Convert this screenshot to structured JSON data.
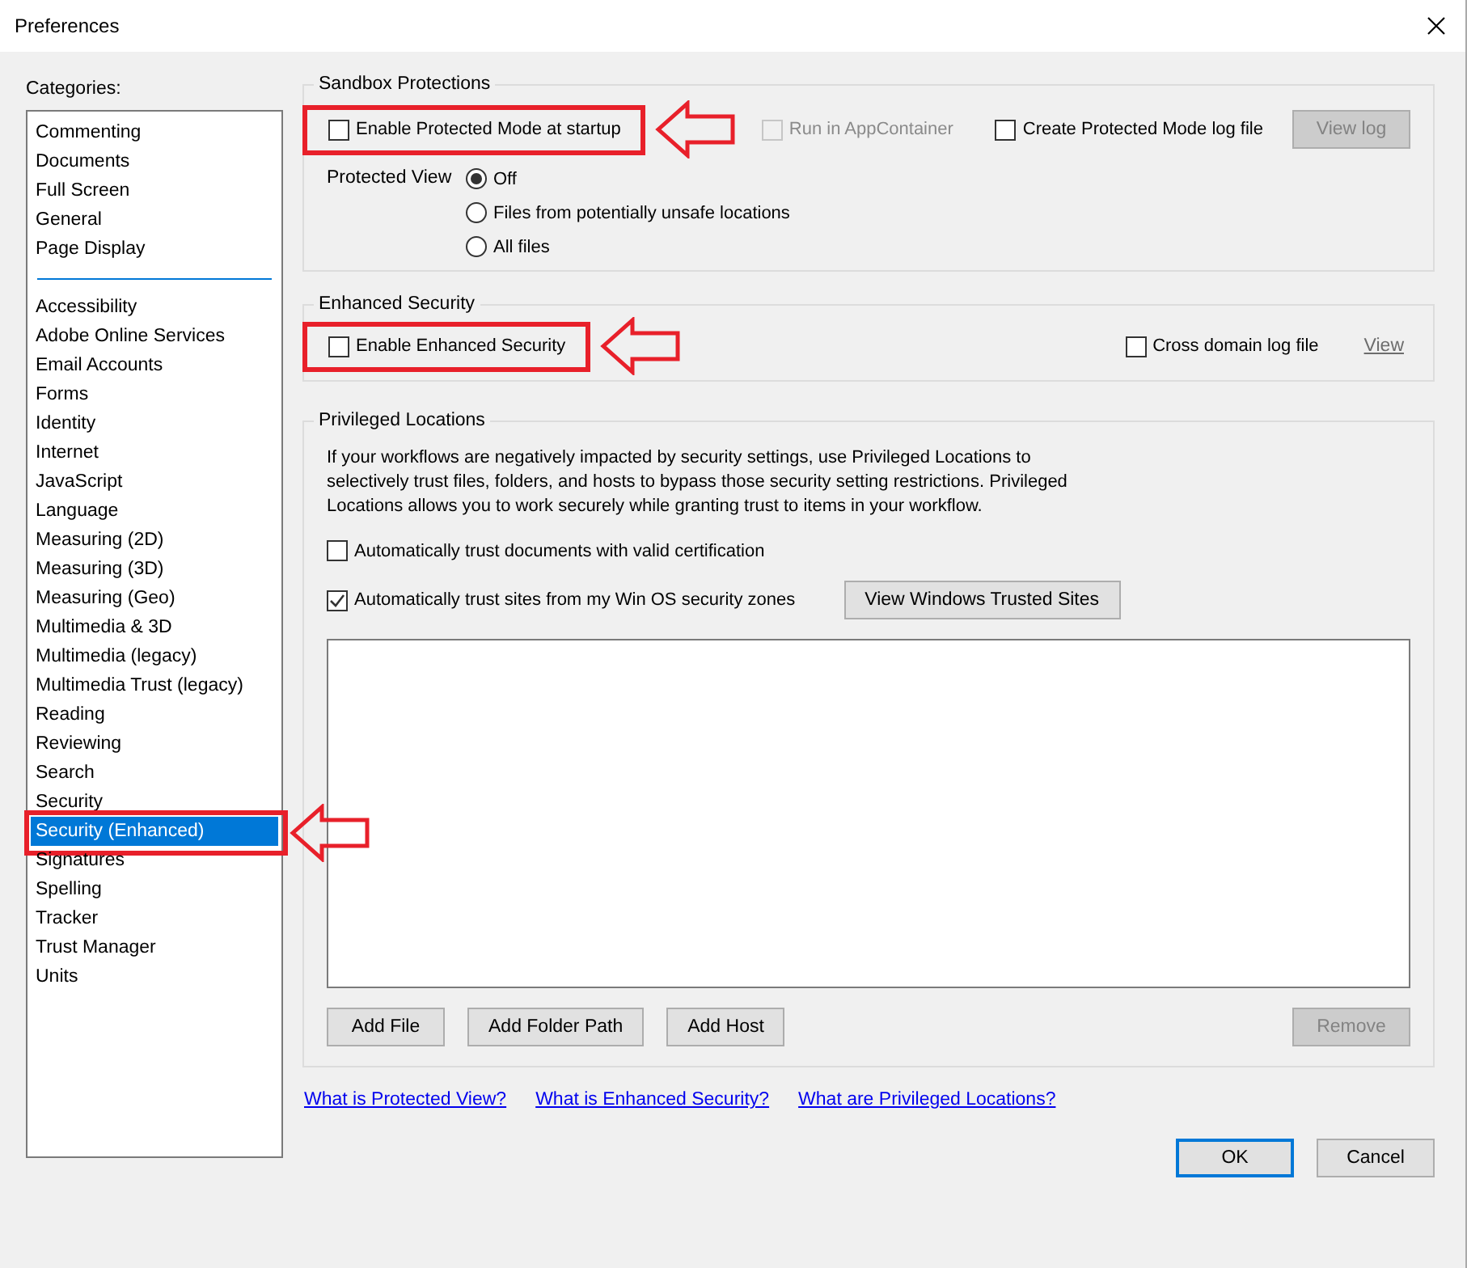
{
  "window": {
    "title": "Preferences"
  },
  "categories_label": "Categories:",
  "categories": [
    {
      "items": [
        {
          "label": "Commenting",
          "selected": false,
          "highlighted": false
        },
        {
          "label": "Documents",
          "selected": false,
          "highlighted": false
        },
        {
          "label": "Full Screen",
          "selected": false,
          "highlighted": false
        },
        {
          "label": "General",
          "selected": false,
          "highlighted": false
        },
        {
          "label": "Page Display",
          "selected": false,
          "highlighted": false
        }
      ]
    },
    {
      "items": [
        {
          "label": "Accessibility",
          "selected": false,
          "highlighted": false
        },
        {
          "label": "Adobe Online Services",
          "selected": false,
          "highlighted": false
        },
        {
          "label": "Email Accounts",
          "selected": false,
          "highlighted": false
        },
        {
          "label": "Forms",
          "selected": false,
          "highlighted": false
        },
        {
          "label": "Identity",
          "selected": false,
          "highlighted": false
        },
        {
          "label": "Internet",
          "selected": false,
          "highlighted": false
        },
        {
          "label": "JavaScript",
          "selected": false,
          "highlighted": false
        },
        {
          "label": "Language",
          "selected": false,
          "highlighted": false
        },
        {
          "label": "Measuring (2D)",
          "selected": false,
          "highlighted": false
        },
        {
          "label": "Measuring (3D)",
          "selected": false,
          "highlighted": false
        },
        {
          "label": "Measuring (Geo)",
          "selected": false,
          "highlighted": false
        },
        {
          "label": "Multimedia & 3D",
          "selected": false,
          "highlighted": false
        },
        {
          "label": "Multimedia (legacy)",
          "selected": false,
          "highlighted": false
        },
        {
          "label": "Multimedia Trust (legacy)",
          "selected": false,
          "highlighted": false
        },
        {
          "label": "Reading",
          "selected": false,
          "highlighted": false
        },
        {
          "label": "Reviewing",
          "selected": false,
          "highlighted": false
        },
        {
          "label": "Search",
          "selected": false,
          "highlighted": false
        },
        {
          "label": "Security",
          "selected": false,
          "highlighted": false
        },
        {
          "label": "Security (Enhanced)",
          "selected": true,
          "highlighted": true
        },
        {
          "label": "Signatures",
          "selected": false,
          "highlighted": false
        },
        {
          "label": "Spelling",
          "selected": false,
          "highlighted": false
        },
        {
          "label": "Tracker",
          "selected": false,
          "highlighted": false
        },
        {
          "label": "Trust Manager",
          "selected": false,
          "highlighted": false
        },
        {
          "label": "Units",
          "selected": false,
          "highlighted": false
        }
      ]
    }
  ],
  "sandbox": {
    "title": "Sandbox Protections",
    "protected_mode": {
      "label": "Enable Protected Mode at startup",
      "checked": false,
      "disabled": false,
      "highlighted": true
    },
    "app_container": {
      "label": "Run in AppContainer",
      "checked": false,
      "disabled": true
    },
    "log_file": {
      "label": "Create Protected Mode log file",
      "checked": false,
      "disabled": false
    },
    "view_log": {
      "label": "View log",
      "disabled": true
    },
    "protected_view": {
      "label": "Protected View",
      "options": [
        {
          "label": "Off",
          "selected": true
        },
        {
          "label": "Files from potentially unsafe locations",
          "selected": false
        },
        {
          "label": "All files",
          "selected": false
        }
      ]
    }
  },
  "enhanced": {
    "title": "Enhanced Security",
    "enable": {
      "label": "Enable Enhanced Security",
      "checked": false,
      "disabled": false,
      "highlighted": true
    },
    "cross_domain": {
      "label": "Cross domain log file",
      "checked": false,
      "disabled": false
    },
    "view_link": {
      "label": "View"
    }
  },
  "privileged": {
    "title": "Privileged Locations",
    "description": "If your workflows are negatively impacted by security settings, use Privileged Locations to selectively trust files, folders, and hosts to bypass those security setting restrictions. Privileged Locations allows you to work securely while granting trust to items in your workflow.",
    "trust_certified": {
      "label": "Automatically trust documents with valid certification",
      "checked": false,
      "disabled": false
    },
    "trust_sites": {
      "label": "Automatically trust sites from my Win OS security zones",
      "checked": true,
      "disabled": false
    },
    "view_sites": {
      "label": "View Windows Trusted Sites",
      "disabled": false
    },
    "buttons": [
      {
        "label": "Add File",
        "disabled": false
      },
      {
        "label": "Add Folder Path",
        "disabled": false
      },
      {
        "label": "Add Host",
        "disabled": false
      }
    ],
    "remove": {
      "label": "Remove",
      "disabled": true
    }
  },
  "links": [
    "What is Protected View?",
    "What is Enhanced Security?",
    "What are Privileged Locations?"
  ],
  "footer": [
    {
      "label": "OK",
      "default": true
    },
    {
      "label": "Cancel",
      "default": false
    }
  ]
}
